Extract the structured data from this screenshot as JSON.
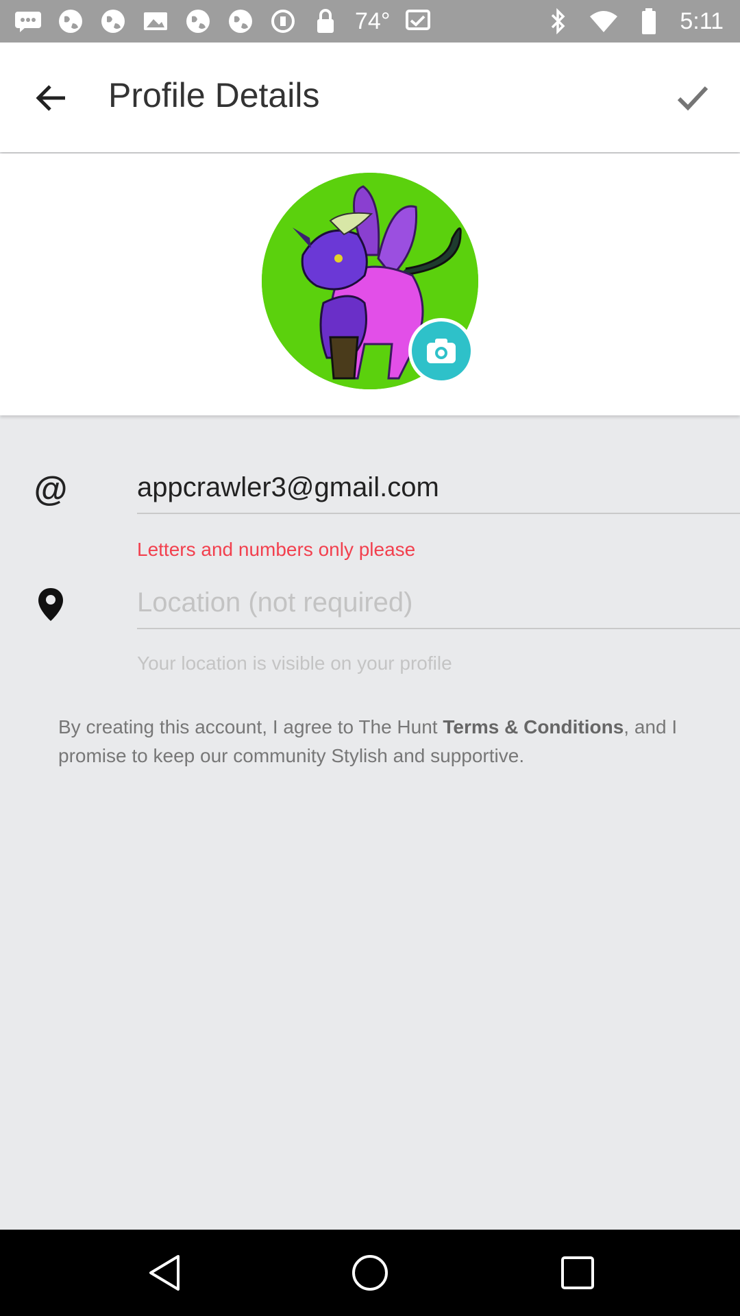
{
  "status_bar": {
    "temperature": "74°",
    "time": "5:11",
    "icons": [
      "messages-icon",
      "globe-icon",
      "globe-icon",
      "gallery-icon",
      "globe-icon",
      "globe-icon",
      "sync-icon",
      "lock-icon",
      "bluetooth-icon",
      "wifi-icon",
      "battery-icon"
    ]
  },
  "header": {
    "title": "Profile Details",
    "back_icon": "arrow-back-icon",
    "confirm_icon": "checkmark-icon"
  },
  "avatar": {
    "camera_icon": "camera-icon"
  },
  "form": {
    "email_value": "appcrawler3@gmail.com",
    "email_error": "Letters and numbers only please",
    "location_placeholder": "Location (not required)",
    "location_hint": "Your location is visible on your profile"
  },
  "terms": {
    "prefix": "By creating this account, I agree to The Hunt ",
    "link": "Terms & Conditions",
    "suffix": ", and I promise to keep our community Stylish and supportive."
  },
  "colors": {
    "accent": "#2ec1c9",
    "error": "#f2404e",
    "avatar_bg": "#5bd10d"
  }
}
